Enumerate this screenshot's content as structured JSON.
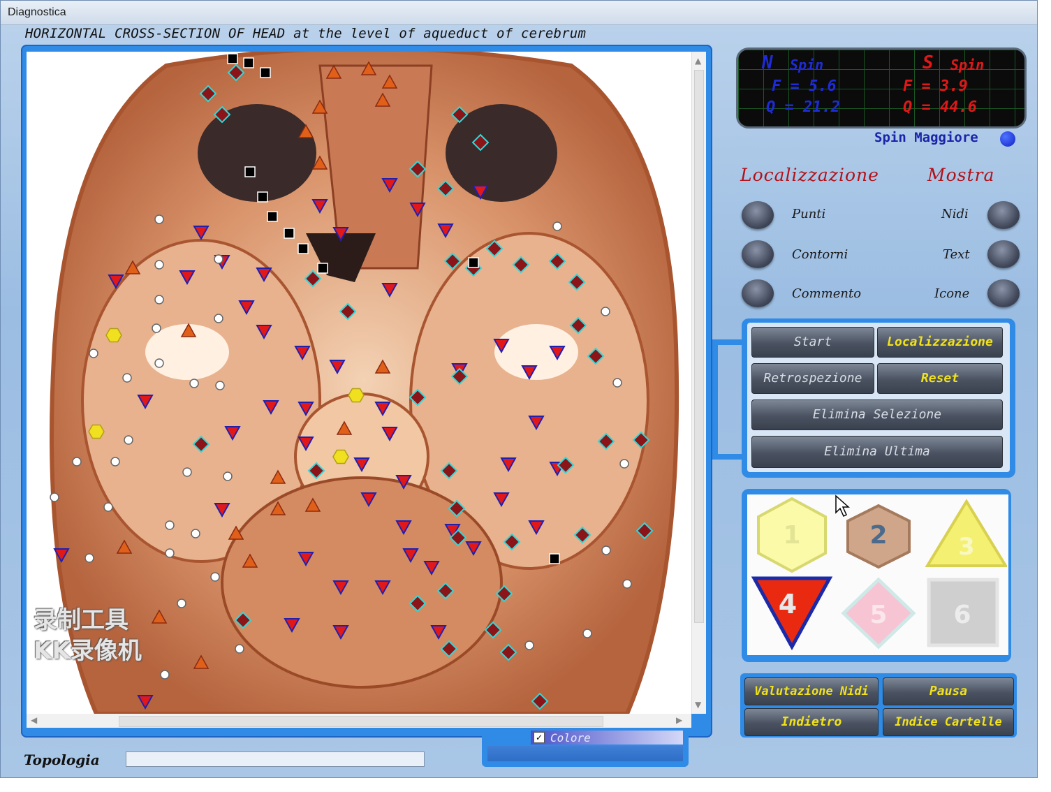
{
  "window": {
    "title": "Diagnostica"
  },
  "heading": "HORIZONTAL CROSS-SECTION OF HEAD at the level of aqueduct of cerebrum",
  "watermark": {
    "line1": "录制工具",
    "line2": "KK录像机"
  },
  "spin": {
    "north": {
      "label": "N",
      "spin": "Spin",
      "f": "F = 5.6",
      "q": "Q = 21.2",
      "color": "#1e2bd6"
    },
    "south": {
      "label": "S",
      "spin": "Spin",
      "f": "F = 3.9",
      "q": "Q = 44.6",
      "color": "#e01818"
    },
    "maggiore_label": "Spin Maggiore",
    "maggiore_color": "#1020c8"
  },
  "localizzazione": {
    "header": "Localizzazione",
    "items": [
      "Punti",
      "Contorni",
      "Commento"
    ]
  },
  "mostra": {
    "header": "Mostra",
    "items": [
      "Nidi",
      "Text",
      "Icone"
    ]
  },
  "buttons": {
    "start": "Start",
    "localizzazione": "Localizzazione",
    "retrospezione": "Retrospezione",
    "reset": "Reset",
    "elimina_selezione": "Elimina Selezione",
    "elimina_ultima": "Elimina Ultima"
  },
  "icons": [
    {
      "number": "1",
      "shape": "yellow-hexagon-icon"
    },
    {
      "number": "2",
      "shape": "brown-hexagon-icon"
    },
    {
      "number": "3",
      "shape": "yellow-triangle-icon"
    },
    {
      "number": "4",
      "shape": "red-triangle-icon"
    },
    {
      "number": "5",
      "shape": "pink-diamond-icon"
    },
    {
      "number": "6",
      "shape": "gray-square-icon"
    }
  ],
  "bottom_buttons": {
    "valutazione_nidi": "Valutazione Nidi",
    "pausa": "Pausa",
    "indietro": "Indietro",
    "indice_cartelle": "Indice Cartelle"
  },
  "colore": {
    "label": "Colore",
    "checked": true
  },
  "topologia": {
    "label": "Topologia",
    "value": ""
  }
}
